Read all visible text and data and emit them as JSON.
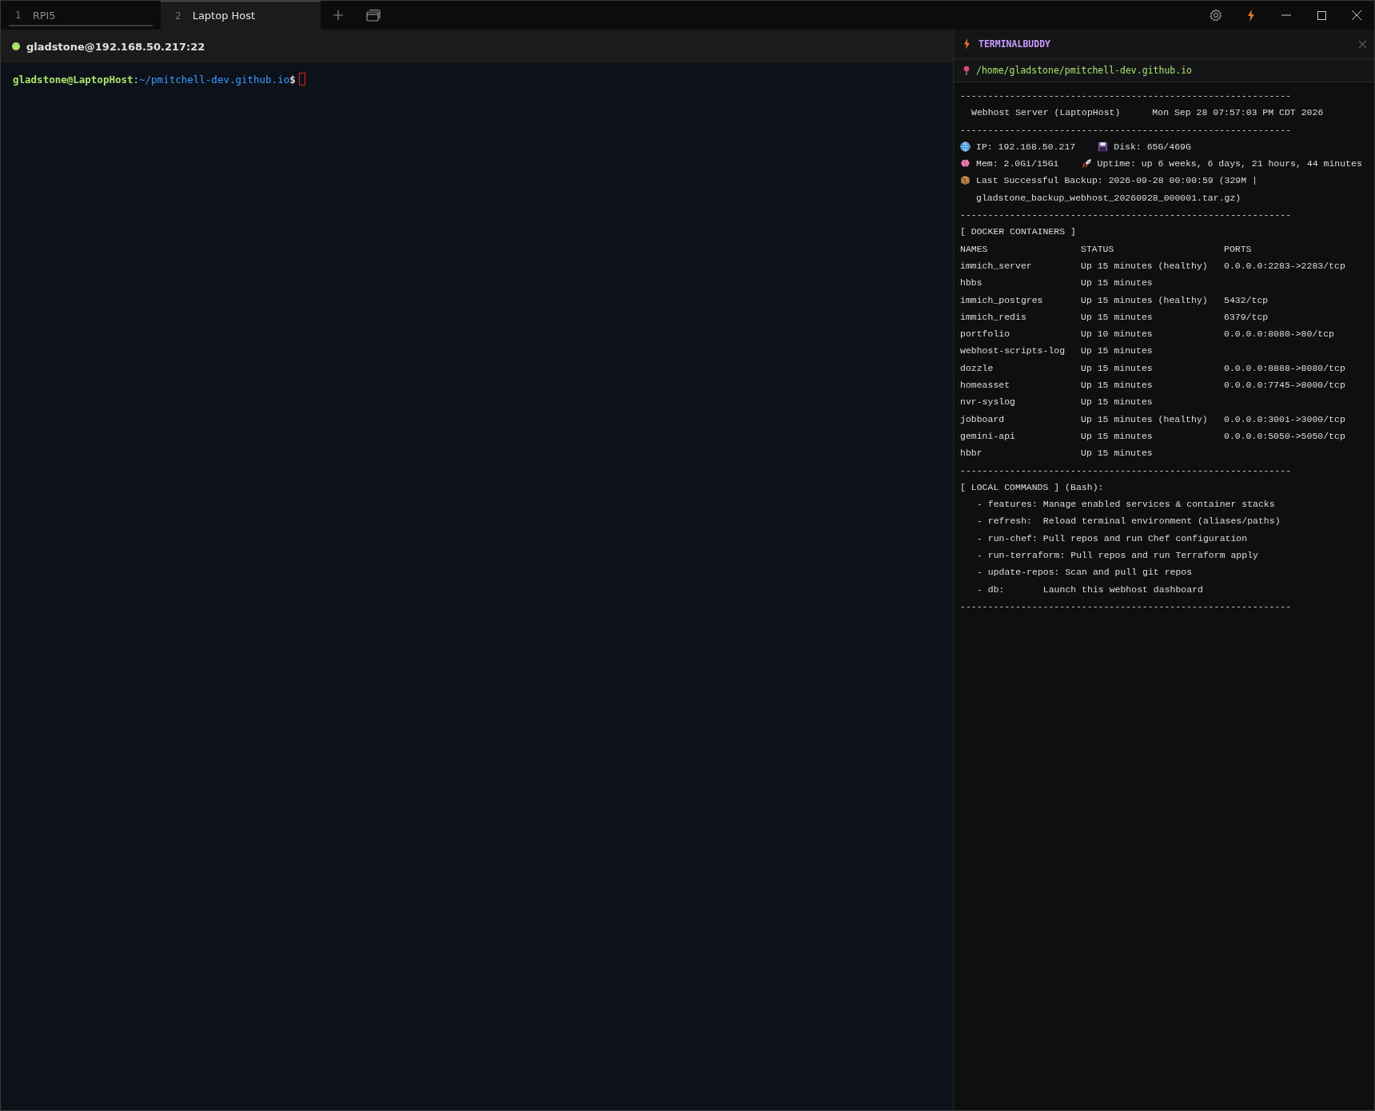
{
  "tabs": [
    {
      "number": "1",
      "label": "RPI5",
      "selected": false
    },
    {
      "number": "2",
      "label": "Laptop Host",
      "selected": true
    }
  ],
  "session": {
    "title": "gladstone@192.168.50.217:22",
    "connected": true
  },
  "prompt": {
    "user_host": "gladstone@LaptopHost",
    "separator": ":",
    "path": "~/pmitchell-dev.github.io",
    "symbol": "$"
  },
  "panel": {
    "title": "TERMINALBUDDY",
    "path": "/home/gladstone/pmitchell-dev.github.io",
    "blocks": [
      {
        "kind": "rule",
        "text": "------------------------------------------------------------"
      },
      {
        "kind": "header",
        "title": "Webhost Server (LaptopHost)",
        "date": "Mon Sep 28 07:57:03 PM CDT 2026"
      },
      {
        "kind": "rule",
        "text": "------------------------------------------------------------"
      },
      {
        "kind": "info",
        "items": [
          "IP: 192.168.50.217",
          "Disk: 65G/469G"
        ]
      },
      {
        "kind": "info",
        "items": [
          "Mem: 2.0Gi/15Gi",
          "Uptime: up 6 weeks, 6 days, 21 hours, 44 minutes"
        ]
      },
      {
        "kind": "info",
        "items": [
          "Last Successful Backup: 2026-09-28 00:00:59 (329M | gladstone_backup_webhost_20260928_000001.tar.gz)"
        ]
      },
      {
        "kind": "rule",
        "text": "------------------------------------------------------------"
      },
      {
        "kind": "heading",
        "text": "[ DOCKER CONTAINERS ]"
      },
      {
        "kind": "table",
        "columns": [
          "NAMES",
          "STATUS",
          "PORTS"
        ],
        "rows": [
          [
            "immich_server",
            "Up 15 minutes (healthy)",
            "0.0.0.0:2283->2283/tcp"
          ],
          [
            "hbbs",
            "Up 15 minutes",
            ""
          ],
          [
            "immich_postgres",
            "Up 15 minutes (healthy)",
            "5432/tcp"
          ],
          [
            "immich_redis",
            "Up 15 minutes",
            "6379/tcp"
          ],
          [
            "portfolio",
            "Up 10 minutes",
            "0.0.0.0:8080->80/tcp"
          ],
          [
            "webhost-scripts-log",
            "Up 15 minutes",
            ""
          ],
          [
            "dozzle",
            "Up 15 minutes",
            "0.0.0.0:8888->8080/tcp"
          ],
          [
            "homeasset",
            "Up 15 minutes",
            "0.0.0.0:7745->8000/tcp"
          ],
          [
            "nvr-syslog",
            "Up 15 minutes",
            ""
          ],
          [
            "jobboard",
            "Up 15 minutes (healthy)",
            "0.0.0.0:3001->3000/tcp"
          ],
          [
            "gemini-api",
            "Up 15 minutes",
            "0.0.0.0:5050->5050/tcp"
          ],
          [
            "hbbr",
            "Up 15 minutes",
            ""
          ]
        ]
      },
      {
        "kind": "rule",
        "text": "------------------------------------------------------------"
      },
      {
        "kind": "heading",
        "text": "[ LOCAL COMMANDS ] (Bash):"
      },
      {
        "kind": "commands",
        "items": [
          "- features: Manage enabled services & container stacks",
          "- refresh:  Reload terminal environment (aliases/paths)",
          "- run-chef: Pull repos and run Chef configuration",
          "- run-terraform: Pull repos and run Terraform apply",
          "- update-repos: Scan and pull git repos",
          "- db:       Launch this webhost dashboard"
        ]
      },
      {
        "kind": "rule",
        "text": "------------------------------------------------------------"
      }
    ]
  }
}
